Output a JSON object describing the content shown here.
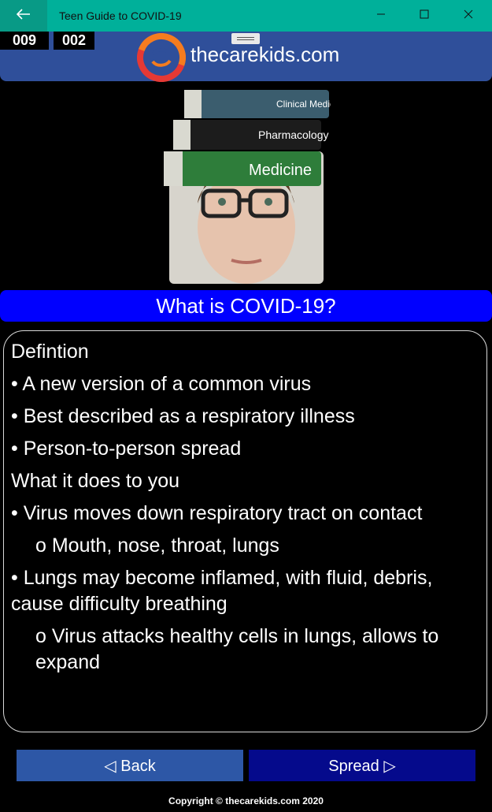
{
  "window": {
    "title": "Teen Guide to COVID-19",
    "back_icon": "arrow-left-icon",
    "minimize_icon": "minimize-icon",
    "maximize_icon": "maximize-icon",
    "close_icon": "close-icon"
  },
  "header": {
    "counter_left": "009",
    "counter_right": "002",
    "site_name": "thecarekids.com",
    "logo_icon": "thecarekids-logo-icon",
    "brand_colors": {
      "banner": "#2f4f9a",
      "logo_red": "#e53935",
      "logo_orange": "#f57c1f"
    }
  },
  "hero": {
    "books": [
      "Clinical Medicine",
      "Pharmacology",
      "Medicine"
    ]
  },
  "section": {
    "title": "What is COVID-19?"
  },
  "content": {
    "lines": [
      {
        "text": "Defintion",
        "indent": false
      },
      {
        "text": "• A new version of a common virus",
        "indent": false
      },
      {
        "text": "• Best described as a respiratory illness",
        "indent": false
      },
      {
        "text": "• Person-to-person spread",
        "indent": false
      },
      {
        "text": "What it does to you",
        "indent": false
      },
      {
        "text": "• Virus moves down respiratory tract on contact",
        "indent": false
      },
      {
        "text": "o Mouth, nose, throat, lungs",
        "indent": true
      },
      {
        "text": "• Lungs may become inflamed, with fluid, debris, cause difficulty breathing",
        "indent": false
      },
      {
        "text": "o Virus attacks healthy cells in lungs, allows to expand",
        "indent": true
      }
    ]
  },
  "footer": {
    "back_label": "◁ Back",
    "next_label": "Spread ▷",
    "copyright": "Copyright © thecarekids.com 2020"
  }
}
